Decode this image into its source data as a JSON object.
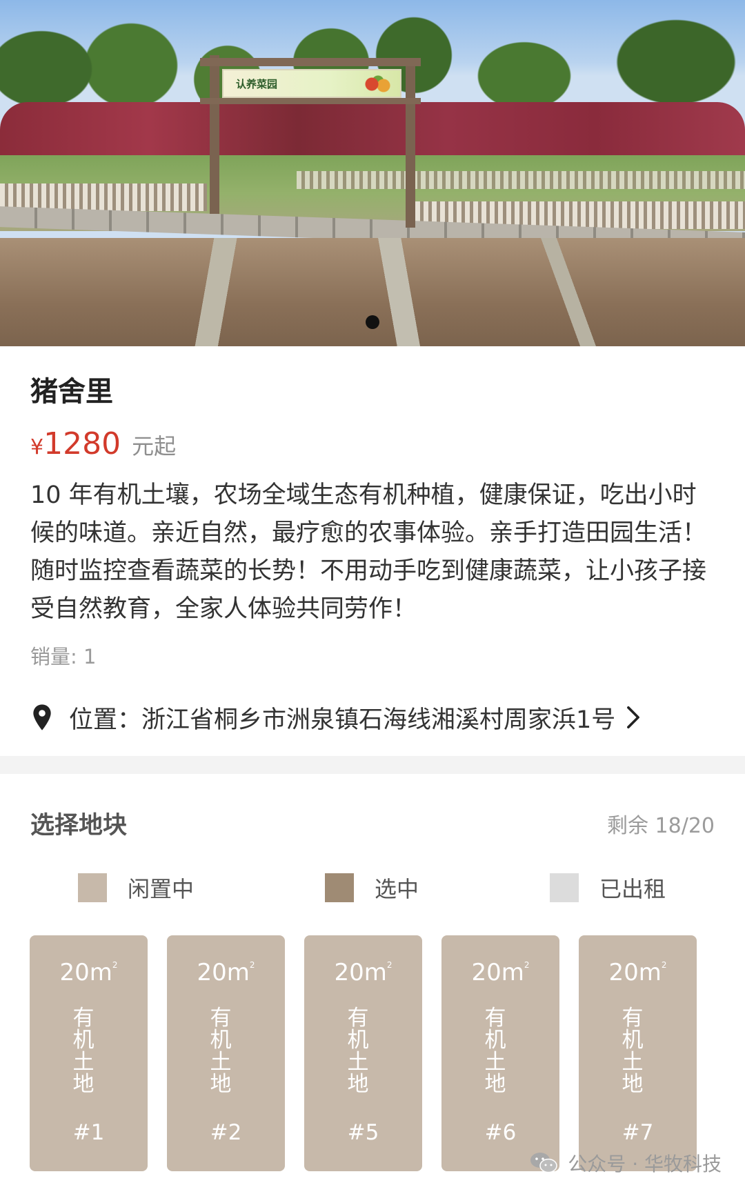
{
  "banner": {
    "sign_text": "认养菜园",
    "active_slide": 1
  },
  "product": {
    "title": "猪舍里",
    "price_symbol": "¥",
    "price": "1280",
    "price_unit": "元起",
    "description": "10 年有机土壤，农场全域生态有机种植，健康保证，吃出小时候的味道。亲近自然，最疗愈的农事体验。亲手打造田园生活！随时监控查看蔬菜的长势！不用动手吃到健康蔬菜，让小孩子接受自然教育，全家人体验共同劳作！",
    "sales": "销量: 1",
    "location": "位置：浙江省桐乡市洲泉镇石海线湘溪村周家浜1号"
  },
  "plot_section": {
    "title": "选择地块",
    "remaining": "剩余 18/20",
    "legend": [
      {
        "label": "闲置中",
        "color": "#c7b9aa"
      },
      {
        "label": "选中",
        "color": "#9f8b74"
      },
      {
        "label": "已出租",
        "color": "#dcdcdc"
      }
    ],
    "plots": [
      {
        "area": "20m",
        "area_sup": "2",
        "kind": [
          "有",
          "机",
          "土",
          "地"
        ],
        "number": "#1"
      },
      {
        "area": "20m",
        "area_sup": "2",
        "kind": [
          "有",
          "机",
          "土",
          "地"
        ],
        "number": "#2"
      },
      {
        "area": "20m",
        "area_sup": "2",
        "kind": [
          "有",
          "机",
          "土",
          "地"
        ],
        "number": "#5"
      },
      {
        "area": "20m",
        "area_sup": "2",
        "kind": [
          "有",
          "机",
          "土",
          "地"
        ],
        "number": "#6"
      },
      {
        "area": "20m",
        "area_sup": "2",
        "kind": [
          "有",
          "机",
          "土",
          "地"
        ],
        "number": "#7"
      }
    ]
  },
  "watermark": "公众号 · 华牧科技",
  "colors": {
    "price": "#d23a2b",
    "plot_idle": "#c7b9aa",
    "plot_selected": "#9f8b74",
    "plot_rented": "#dcdcdc"
  }
}
